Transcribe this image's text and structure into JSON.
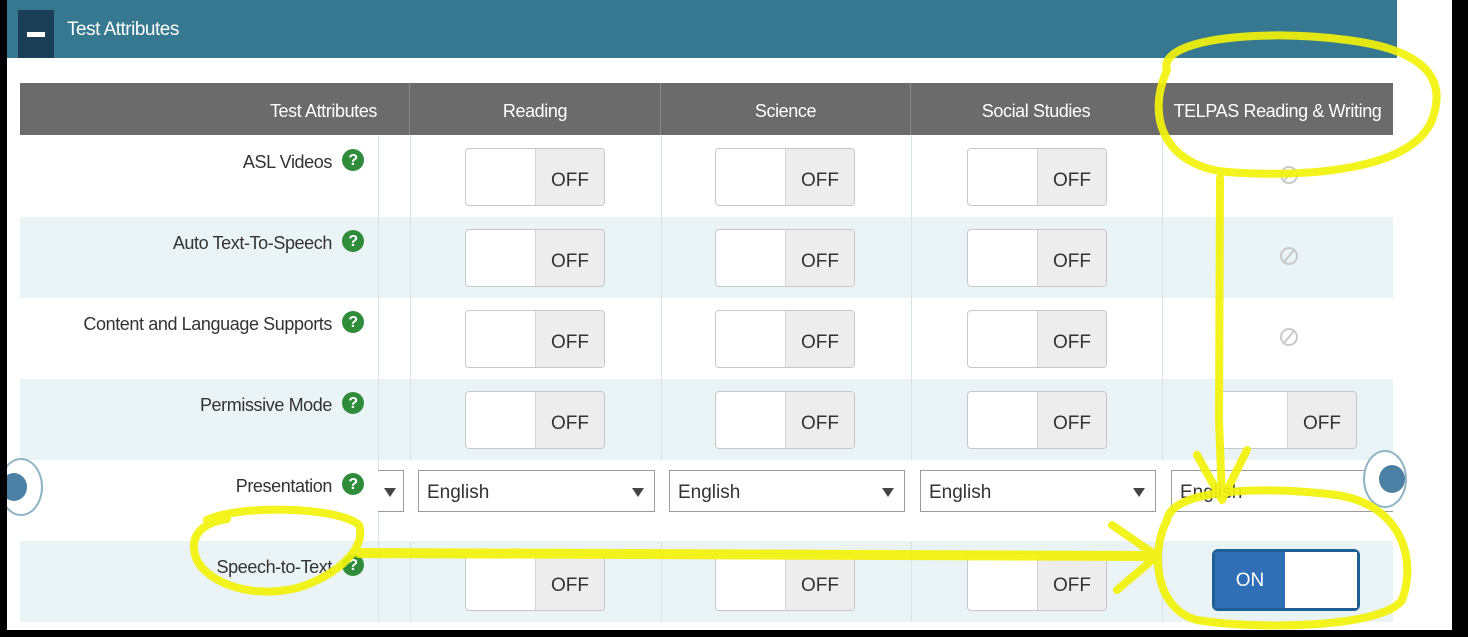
{
  "panel": {
    "title": "Test Attributes"
  },
  "columns": [
    "Test Attributes",
    "Reading",
    "Science",
    "Social Studies",
    "TELPAS Reading & Writing"
  ],
  "rows": [
    {
      "label": "ASL Videos",
      "cells": [
        "OFF",
        "OFF",
        "OFF"
      ],
      "telpas": "disabled"
    },
    {
      "label": "Auto Text-To-Speech",
      "cells": [
        "OFF",
        "OFF",
        "OFF"
      ],
      "telpas": "disabled"
    },
    {
      "label": "Content and Language Supports",
      "cells": [
        "OFF",
        "OFF",
        "OFF"
      ],
      "telpas": "disabled"
    },
    {
      "label": "Permissive Mode",
      "cells": [
        "OFF",
        "OFF",
        "OFF"
      ],
      "telpas": "OFF"
    },
    {
      "label": "Presentation",
      "cells": [
        "English",
        "English",
        "English"
      ],
      "telpas": "English"
    },
    {
      "label": "Speech-to-Text",
      "cells": [
        "OFF",
        "OFF",
        "OFF"
      ],
      "telpas": "ON"
    }
  ],
  "help_glyph": "?",
  "colors": {
    "header": "#35788f",
    "grid_header": "#6b6b6b",
    "help": "#2f8c3a",
    "on": "#2e6fb5",
    "highlight": "#f2f20a"
  }
}
